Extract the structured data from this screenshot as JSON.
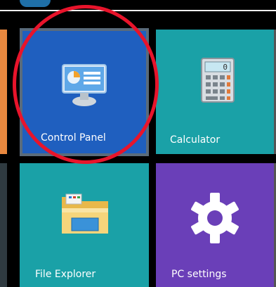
{
  "tiles": {
    "control_panel": {
      "label": "Control Panel",
      "icon": "control-panel-icon",
      "color": "#1f5fbf"
    },
    "calculator": {
      "label": "Calculator",
      "icon": "calculator-icon",
      "color": "#1aa1a7"
    },
    "file_explorer": {
      "label": "File Explorer",
      "icon": "file-explorer-icon",
      "color": "#1aa1a7"
    },
    "pc_settings": {
      "label": "PC settings",
      "icon": "gear-icon",
      "color": "#6a3fb8"
    }
  },
  "calculator_display": "0",
  "highlight": {
    "color": "#e8142b",
    "target": "control_panel"
  }
}
